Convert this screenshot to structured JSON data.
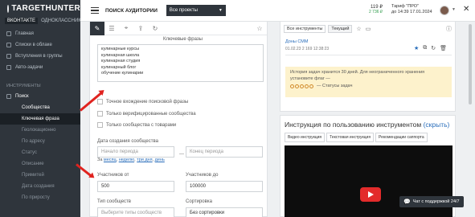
{
  "brand": {
    "name": "TARGETHUNTER",
    "sources": [
      "ВКОНТАКТЕ",
      "ОДНОКЛАССНИКИ"
    ]
  },
  "sidebar": {
    "main_items": [
      "Главная",
      "Списки в облаке",
      "Вступления в группы",
      "Авто-задачи"
    ],
    "section_label": "ИНСТРУМЕНТЫ",
    "search_label": "Поиск",
    "communities_label": "Сообщества",
    "sub_items": [
      "Ключевая фраза",
      "Геолокационно",
      "По адресу",
      "Статус",
      "Описание",
      "Примитей",
      "Дата создания",
      "По приросту"
    ]
  },
  "topbar": {
    "page_title": "ПОИСК АУДИТОРИИ",
    "project": "Все проекты",
    "balance": "119 ₽",
    "balance_extra": "2 736 ₽",
    "tariff_line1": "Тариф \"ПРО\"",
    "tariff_line2": "до 14:39 17.01.2024"
  },
  "form": {
    "phrases_label": "Ключевые фразы",
    "phrases": [
      "кулинарные курсы",
      "кулинарная школа",
      "кулинарная студия",
      "кулинарный блог",
      "обучение кулинарии"
    ],
    "chk_exact": "Точное вхождение поисковой фразы",
    "chk_verified": "Только верифицированные сообщества",
    "chk_goods": "Только сообщества с товарами",
    "date_label": "Дата создания сообщества",
    "date_from_placeholder": "Начало периода",
    "date_to_placeholder": "Конец периода",
    "date_sep": "—",
    "quick_prefix": "За",
    "quick_links": [
      "месяц",
      "неделю",
      "три дня",
      "день"
    ],
    "members_from_label": "Участников от",
    "members_from_value": "500",
    "members_to_label": "Участников до",
    "members_to_value": "100000",
    "type_label": "Тип сообществ",
    "type_placeholder": "Выберите типы сообществ",
    "sort_label": "Сортировка",
    "sort_value": "Без сортировки"
  },
  "tasks": {
    "tabs": [
      "Все инструменты",
      "Текущий"
    ],
    "task_title": "Доны СММ",
    "task_meta": "01.02.23   2 169   12:38:23",
    "notice_text": "История задач хранится 30 дней. Для неограниченного хранения установите флаг —",
    "notice_status": "— Статусы задач"
  },
  "instructions": {
    "title": "Инструкция по пользованию инструментом",
    "hide_link": "(скрыть)",
    "tabs": [
      "Видео инструкция",
      "Текстовая инструкция",
      "Рекомендации саппорта"
    ]
  },
  "chat": {
    "label": "Чат с поддержкой 24/7"
  },
  "colors": {
    "sidebar": "#2f353c",
    "accent_link": "#2a6ebb",
    "annotation_arrow": "#e0231f",
    "notice_bg": "#fdf2cc"
  }
}
